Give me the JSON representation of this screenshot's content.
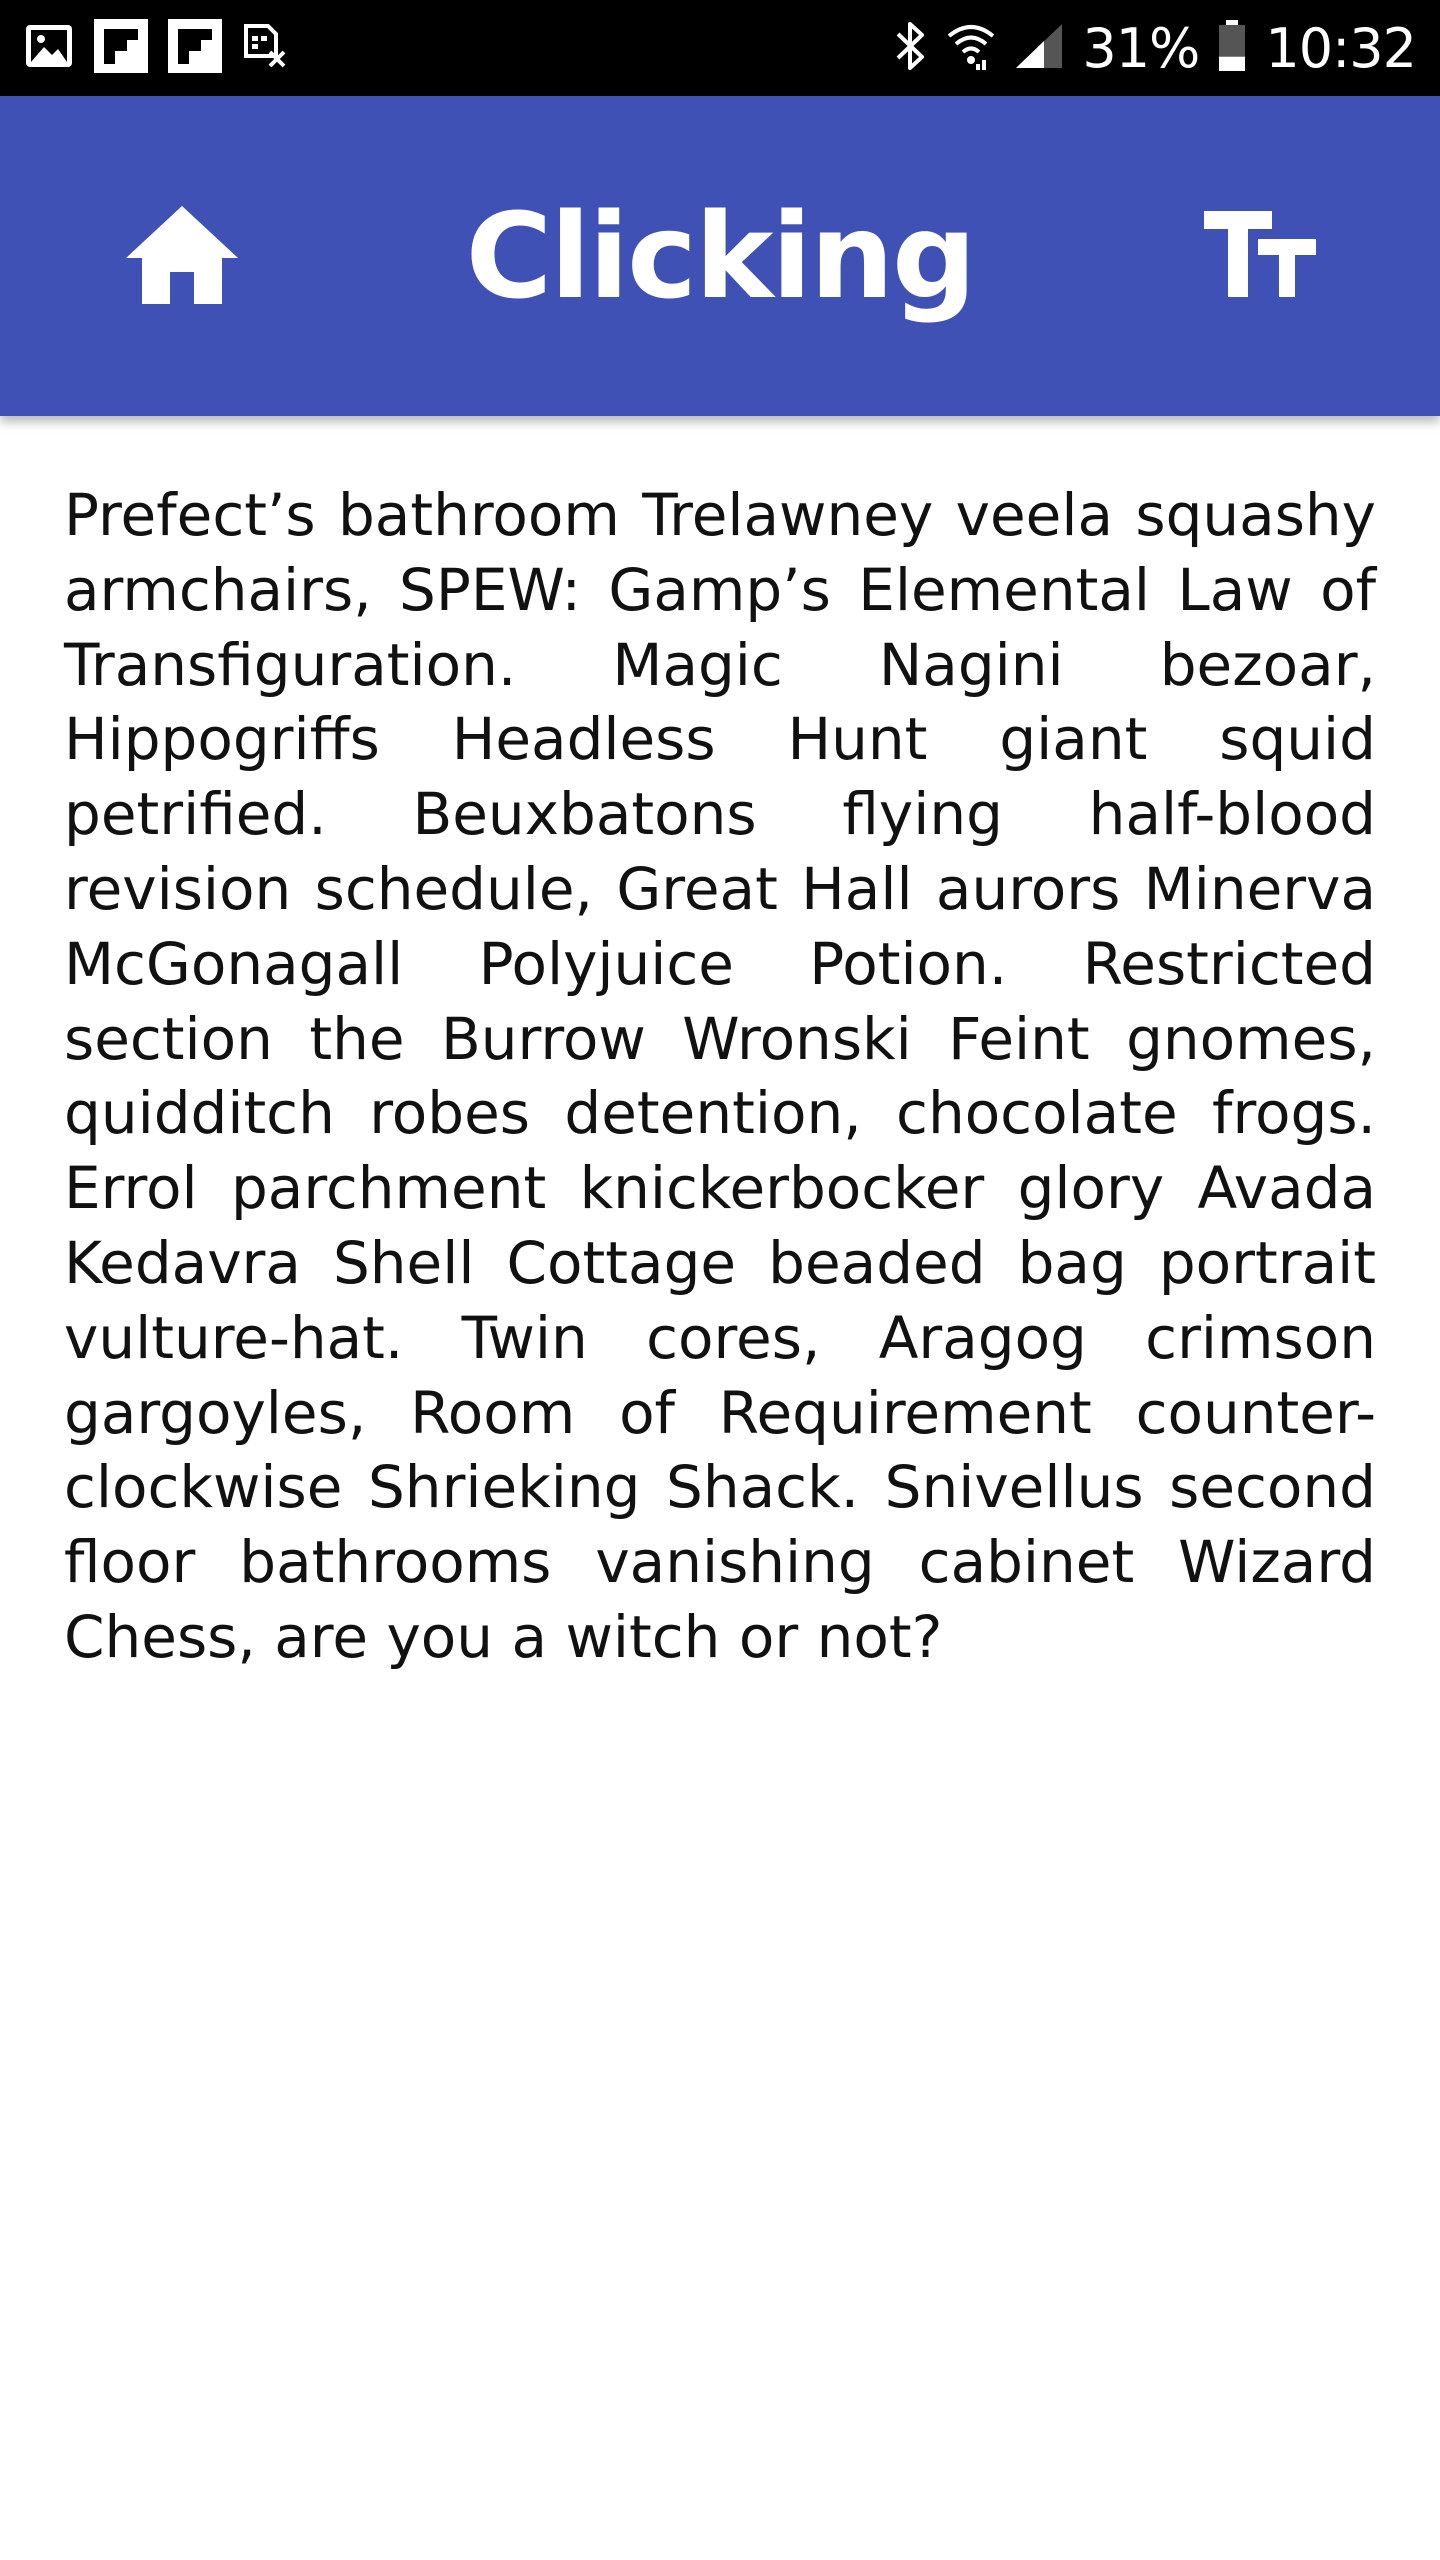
{
  "status_bar": {
    "notification_icons": [
      "image-icon",
      "flipboard-icon",
      "flipboard-icon",
      "sim-off-icon"
    ],
    "system_icons": [
      "bluetooth-icon",
      "wifi-icon",
      "signal-icon"
    ],
    "battery_percent": "31%",
    "battery_level": 0.31,
    "time": "10:32"
  },
  "app_bar": {
    "title": "Clicking",
    "background_color": "#3f51b5",
    "home_icon": "home-icon",
    "text_size_icon": "text-size-icon"
  },
  "content": {
    "body": "Prefect’s bathroom Trelawney veela squashy armchairs, SPEW: Gamp’s Elemental Law of Transfiguration. Magic Nagini bezoar, Hippogriffs Headless Hunt giant squid petrified. Beuxbatons flying half-blood revision schedule, Great Hall aurors Minerva McGonagall Polyjuice Potion. Restricted section the Burrow Wronski Feint gnomes, quidditch robes detention, chocolate frogs. Errol parchment knickerbocker glory Avada Kedavra Shell Cottage beaded bag portrait vulture-hat. Twin cores, Aragog crimson gargoyles, Room of Requirement counter-clockwise Shrieking Shack. Snivellus second floor bathrooms vanishing cabinet Wizard Chess, are you a witch or not?"
  }
}
